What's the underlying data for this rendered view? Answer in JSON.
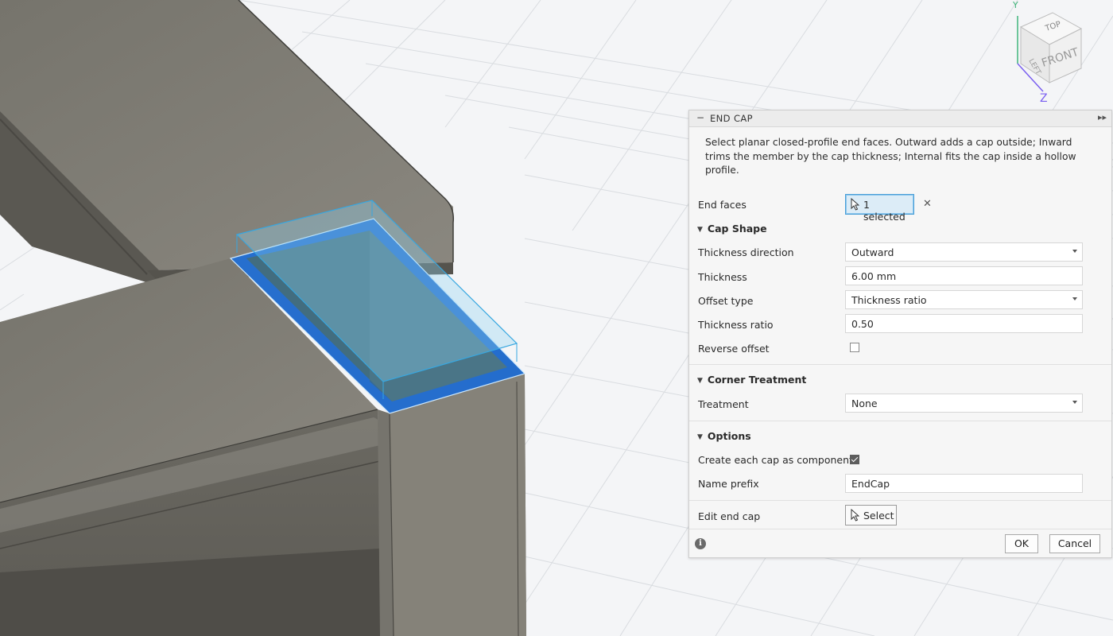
{
  "viewcube": {
    "faces": [
      "TOP",
      "FRONT",
      "LEFT"
    ],
    "axes": [
      "Y",
      "Z"
    ]
  },
  "panel": {
    "title": "END CAP",
    "description": "Select planar closed-profile end faces. Outward adds a cap outside; Inward trims the member by the cap thickness; Internal fits the cap inside a hollow profile.",
    "end_faces": {
      "label": "End faces",
      "value": "1 selected"
    },
    "cap_shape": {
      "header": "Cap Shape",
      "thickness_direction": {
        "label": "Thickness direction",
        "value": "Outward"
      },
      "thickness": {
        "label": "Thickness",
        "value": "6.00 mm"
      },
      "offset_type": {
        "label": "Offset type",
        "value": "Thickness ratio"
      },
      "thickness_ratio": {
        "label": "Thickness ratio",
        "value": "0.50"
      },
      "reverse_offset": {
        "label": "Reverse offset",
        "checked": false
      }
    },
    "corner_treatment": {
      "header": "Corner Treatment",
      "treatment": {
        "label": "Treatment",
        "value": "None"
      }
    },
    "options": {
      "header": "Options",
      "create_component": {
        "label": "Create each cap as component",
        "checked": true
      },
      "name_prefix": {
        "label": "Name prefix",
        "value": "EndCap"
      }
    },
    "edit_end_cap": {
      "label": "Edit end cap",
      "button": "Select"
    },
    "ok": "OK",
    "cancel": "Cancel"
  }
}
